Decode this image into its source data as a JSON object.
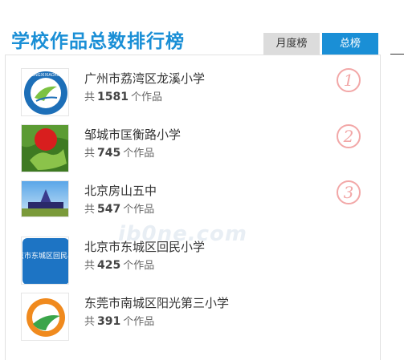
{
  "header": {
    "title": "学校作品总数排行榜"
  },
  "tabs": [
    {
      "label": "月度榜"
    },
    {
      "label": "总榜"
    }
  ],
  "watermark": "ib0ne.com",
  "ranking": [
    {
      "school": "广州市荔湾区龙溪小学",
      "prefix": "共",
      "count": "1581",
      "suffix": "个作品",
      "rank": "1",
      "logo_text": "LONGXIXIAOXUE"
    },
    {
      "school": "邹城市匡衡路小学",
      "prefix": "共",
      "count": "745",
      "suffix": "个作品",
      "rank": "2"
    },
    {
      "school": "北京房山五中",
      "prefix": "共",
      "count": "547",
      "suffix": "个作品",
      "rank": "3"
    },
    {
      "school": "北京市东城区回民小学",
      "prefix": "共",
      "count": "425",
      "suffix": "个作品",
      "logo_text": "北京市东城区回民小学"
    },
    {
      "school": "东莞市南城区阳光第三小学",
      "prefix": "共",
      "count": "391",
      "suffix": "个作品"
    }
  ],
  "colors": {
    "accent": "#1a8fd6",
    "rank_circle": "#f2a7a7"
  }
}
